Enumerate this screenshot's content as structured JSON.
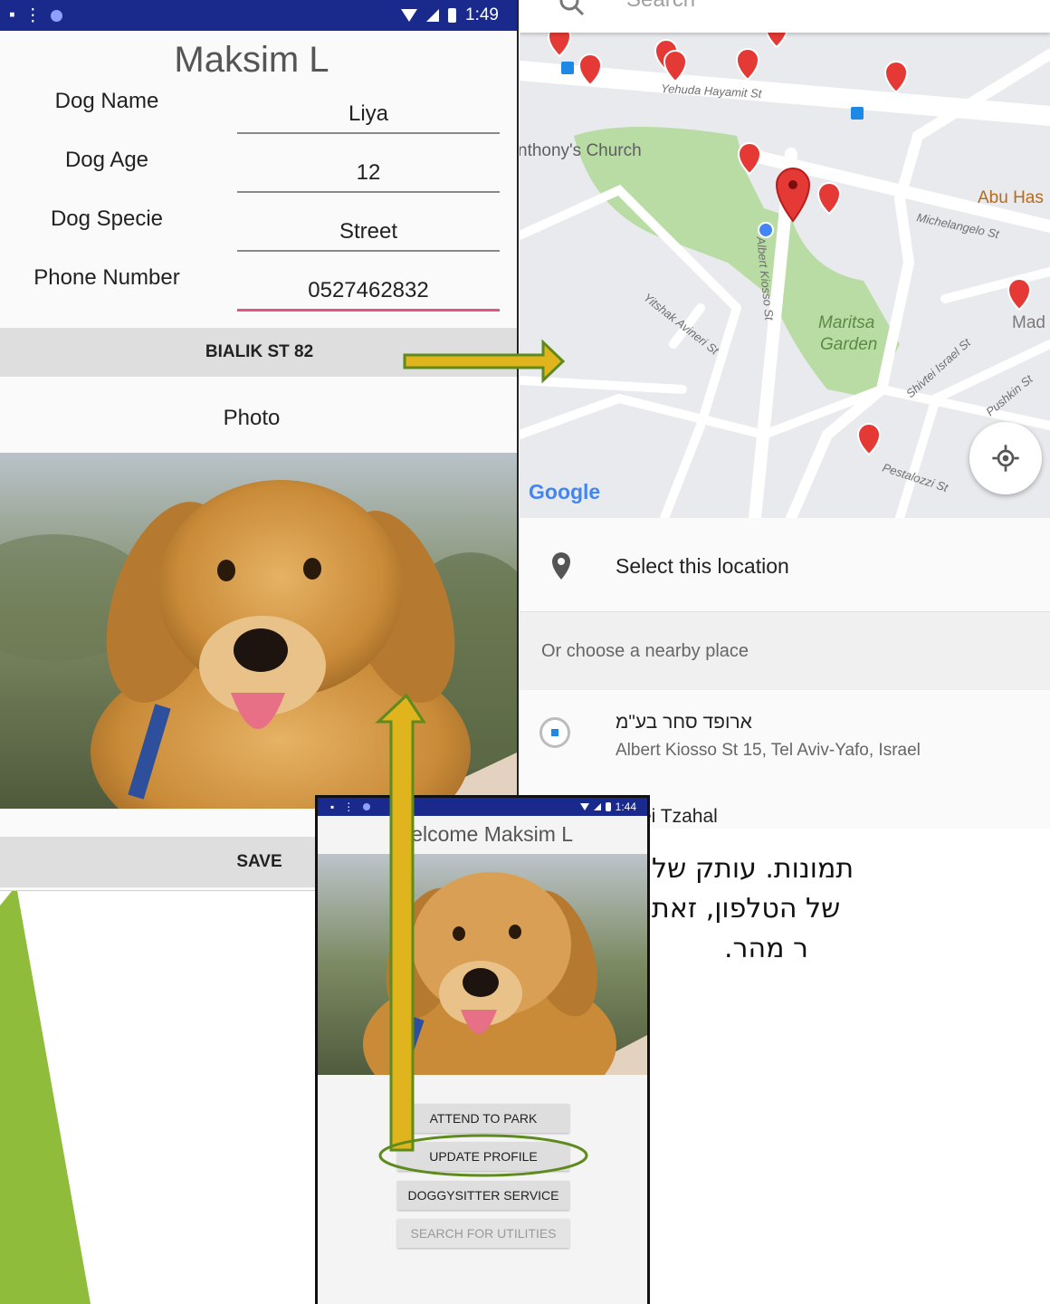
{
  "profile_screen": {
    "status_time": "1:49",
    "title": "Maksim L",
    "fields": [
      {
        "label": "Dog Name",
        "value": "Liya"
      },
      {
        "label": "Dog Age",
        "value": "12"
      },
      {
        "label": "Dog Specie",
        "value": "Street"
      },
      {
        "label": "Phone Number",
        "value": "0527462832"
      }
    ],
    "address_button": "BIALIK ST 82",
    "photo_label": "Photo",
    "save_button": "SAVE"
  },
  "map_screen": {
    "search_placeholder": "Search",
    "street_labels": {
      "yehuda": "Yehuda Hayamit St",
      "church": "nthony's Church",
      "abu": "Abu Has",
      "michelangelo": "Michelangelo St",
      "kiosso": "Albert Kiosso St",
      "aviner": "Yitshak Avineri St",
      "maritsa1": "Maritsa",
      "maritsa2": "Garden",
      "shivtei": "Shivtei Israel St",
      "pushkin": "Pushkin St",
      "mad": "Mad",
      "pestalozzi": "Pestalozzi St"
    },
    "google_logo": "Google",
    "select_location": "Select this location",
    "nearby_header": "Or choose a nearby place",
    "places": [
      {
        "name": "ארופד סחר בע\"מ",
        "address": "Albert Kiosso St 15, Tel Aviv-Yafo, Israel"
      },
      {
        "name": "ei Tzahal"
      }
    ]
  },
  "menu_screen": {
    "status_time": "1:44",
    "title": "Welcome Maksim L",
    "buttons": [
      {
        "label": "ATTEND TO PARK",
        "enabled": true
      },
      {
        "label": "UPDATE PROFILE",
        "enabled": true
      },
      {
        "label": "DOGGYSITTER SERVICE",
        "enabled": true
      },
      {
        "label": "SEARCH FOR UTILITIES",
        "enabled": false
      }
    ]
  },
  "slide_text": {
    "lines": [
      "תמונות. עותק של",
      "של הטלפון, זאת",
      "ר מהר."
    ]
  },
  "colors": {
    "status_bar": "#1a2a8c",
    "accent_pink": "#e5557e",
    "arrow_fill": "#e0b41c",
    "arrow_stroke": "#5f8a1d",
    "slide_green": "#8fbc3b",
    "map_pin_red": "#e53935"
  },
  "icons": [
    "search-icon",
    "map-pin-icon",
    "my-location-icon",
    "place-radio-icon",
    "wifi-icon",
    "signal-icon",
    "battery-icon"
  ]
}
